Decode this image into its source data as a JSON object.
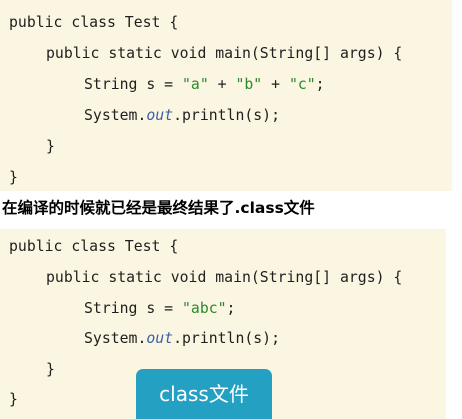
{
  "block_top": {
    "line1": "public class Test {",
    "line2": "public static void main(String[] args) {",
    "line3_prefix": "String s = ",
    "line3_a": "\"a\"",
    "line3_plus1": " + ",
    "line3_b": "\"b\"",
    "line3_plus2": " + ",
    "line3_c": "\"c\"",
    "line3_suffix": ";",
    "line4_prefix": "System.",
    "line4_italic": "out",
    "line4_suffix": ".println(s);",
    "line5": "}",
    "line6": "}"
  },
  "caption": "在编译的时候就已经是最终结果了.class文件",
  "block_bottom": {
    "line1": "public class Test {",
    "line2": "public static void main(String[] args) {",
    "line3_prefix": "String s = ",
    "line3_str": "\"abc\"",
    "line3_suffix": ";",
    "line4_prefix": "System.",
    "line4_italic": "out",
    "line4_suffix": ".println(s);",
    "line5": "}",
    "line6": "}"
  },
  "badge": "class文件",
  "colors": {
    "code_background": "#fbf6e1",
    "string_literal": "#2a8a2a",
    "static_field": "#3b5fa8",
    "badge_background": "#24a0c2"
  }
}
